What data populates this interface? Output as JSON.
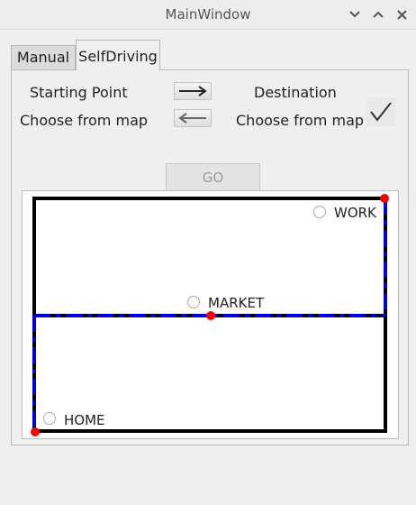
{
  "window": {
    "title": "MainWindow",
    "controls": [
      "minimize-icon",
      "maximize-icon",
      "close-icon"
    ]
  },
  "tabs": [
    {
      "label": "Manual",
      "active": false
    },
    {
      "label": "SelfDriving",
      "active": true
    }
  ],
  "selfdriving": {
    "start_label": "Starting Point",
    "start_hint": "Choose from map",
    "dest_label": "Destination",
    "dest_hint": "Choose from map",
    "go_label": "GO",
    "go_enabled": false
  },
  "map": {
    "places": [
      {
        "name": "WORK",
        "selected": false
      },
      {
        "name": "MARKET",
        "selected": false
      },
      {
        "name": "HOME",
        "selected": false
      }
    ],
    "route_color": "#0000dd",
    "road_color": "#000000",
    "marker_color": "#ff0000"
  }
}
